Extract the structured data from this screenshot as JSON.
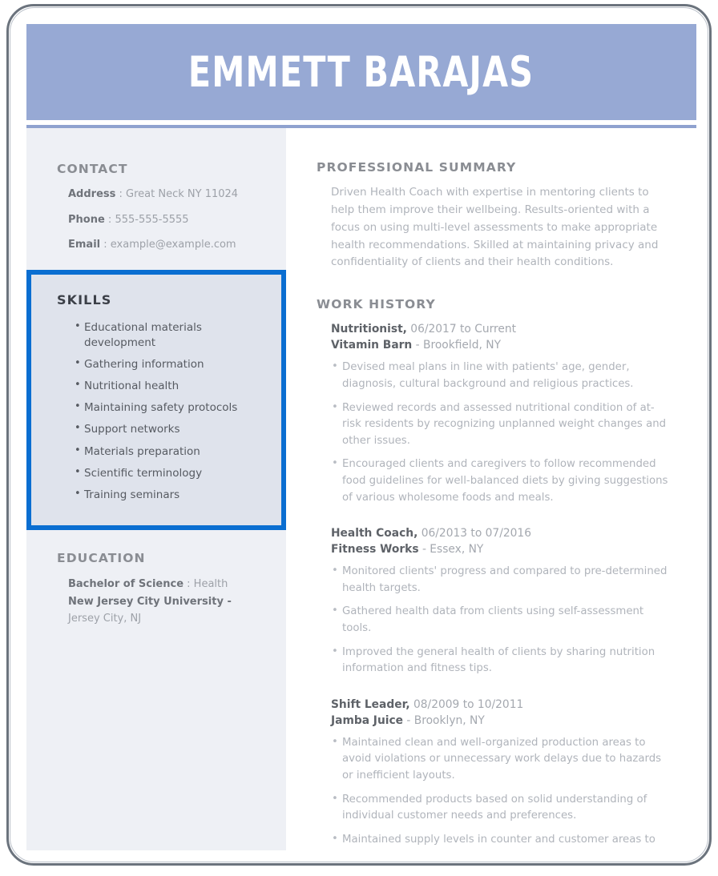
{
  "header": {
    "name": "EMMETT BARAJAS"
  },
  "sidebar": {
    "contact": {
      "heading": "CONTACT",
      "items": [
        {
          "label": "Address",
          "sep": " : ",
          "value": "Great Neck NY 11024"
        },
        {
          "label": "Phone",
          "sep": " : ",
          "value": "555-555-5555"
        },
        {
          "label": "Email",
          "sep": " : ",
          "value": "example@example.com"
        }
      ]
    },
    "skills": {
      "heading": "SKILLS",
      "selected": true,
      "selection_color": "#0a6ed1",
      "items": [
        "Educational materials development",
        "Gathering information",
        "Nutritional health",
        "Maintaining safety protocols",
        "Support networks",
        "Materials preparation",
        "Scientific terminology",
        "Training seminars"
      ]
    },
    "education": {
      "heading": "EDUCATION",
      "degree_label": "Bachelor of Science",
      "degree_sep": " : ",
      "degree_field": "Health",
      "school": "New Jersey City University",
      "school_sep": " -",
      "location": "Jersey City, NJ"
    }
  },
  "main": {
    "summary": {
      "heading": "PROFESSIONAL SUMMARY",
      "text": "Driven Health Coach with expertise in mentoring clients to help them improve their wellbeing. Results-oriented with a focus on using multi-level assessments to make appropriate health recommendations. Skilled at maintaining privacy and confidentiality of clients and their health conditions."
    },
    "work_history": {
      "heading": "WORK HISTORY",
      "jobs": [
        {
          "title": "Nutritionist,",
          "dates": " 06/2017 to Current",
          "company": "Vitamin Barn",
          "location": " - Brookfield, NY",
          "bullets": [
            "Devised meal plans in line with patients' age, gender, diagnosis, cultural background and religious practices.",
            "Reviewed records and assessed nutritional condition of at-risk residents by recognizing unplanned weight changes and other issues.",
            "Encouraged clients and caregivers to follow recommended food guidelines for well-balanced diets by giving suggestions of various wholesome foods and meals."
          ]
        },
        {
          "title": "Health Coach,",
          "dates": " 06/2013 to 07/2016",
          "company": "Fitness Works",
          "location": " - Essex, NY",
          "bullets": [
            "Monitored clients' progress and compared to pre-determined health targets.",
            "Gathered health data from clients using self-assessment tools.",
            "Improved the general health of clients by sharing nutrition information and fitness tips."
          ]
        },
        {
          "title": "Shift Leader,",
          "dates": " 08/2009 to 10/2011",
          "company": "Jamba Juice",
          "location": " - Brooklyn, NY",
          "bullets": [
            "Maintained clean and well-organized production areas to avoid violations or unnecessary work delays due to hazards or inefficient layouts.",
            "Recommended products based on solid understanding of individual customer needs and preferences.",
            "Maintained supply levels in counter and customer areas to meet typical demands."
          ]
        }
      ]
    }
  }
}
